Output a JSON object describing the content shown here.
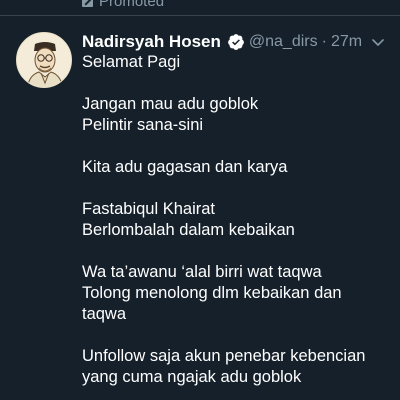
{
  "promoted": {
    "label": "Promoted",
    "icon": "promoted-arrow-icon"
  },
  "tweet": {
    "display_name": "Nadirsyah Hosen",
    "verified": true,
    "verified_icon": "verified-badge-icon",
    "handle": "@na_dirs",
    "separator": "·",
    "time": "27m",
    "menu_icon": "chevron-down-icon",
    "paragraphs": [
      [
        "Selamat Pagi"
      ],
      [
        "Jangan mau adu goblok",
        "Pelintir sana-sini"
      ],
      [
        "Kita adu gagasan dan karya"
      ],
      [
        "Fastabiqul Khairat",
        "Berlombalah dalam kebaikan"
      ],
      [
        "Wa ta’awanu ‘alal birri wat taqwa",
        "Tolong menolong dlm kebaikan dan",
        "taqwa"
      ],
      [
        "Unfollow saja akun penebar kebencian",
        "yang cuma ngajak adu goblok"
      ]
    ]
  },
  "colors": {
    "background": "#15202b",
    "text": "#ffffff",
    "muted": "#8899a6",
    "verified": "#1da1f2",
    "divider": "#38444d"
  }
}
